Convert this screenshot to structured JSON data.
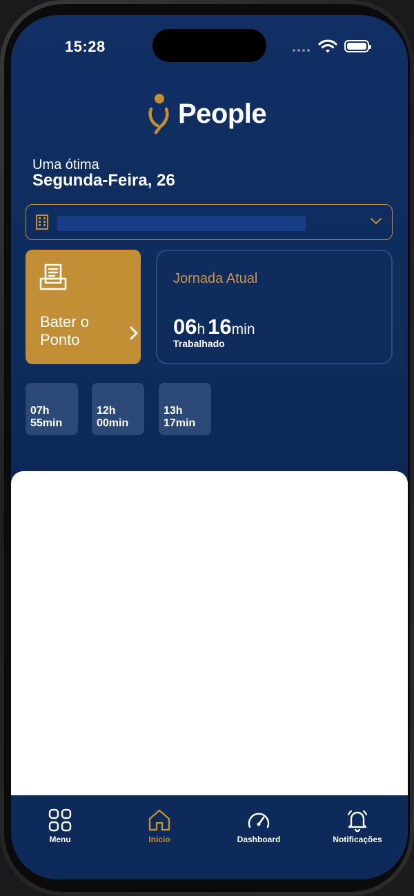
{
  "status_bar": {
    "time": "15:28"
  },
  "brand": {
    "name": "People",
    "accent": "#c28f36",
    "background": "#0e2b5b"
  },
  "header": {
    "greeting": "Uma ótima",
    "date": "Segunda-Feira, 26"
  },
  "company_select": {
    "icon": "building-icon",
    "value": ""
  },
  "punch_card": {
    "label": "Bater o Ponto",
    "icon": "punch-clock-icon"
  },
  "journey": {
    "title": "Jornada Atual",
    "hours": "06",
    "hours_unit": "h",
    "minutes": "16",
    "minutes_unit": "min",
    "caption": "Trabalhado"
  },
  "time_chips": [
    {
      "hours": "07h",
      "minutes": "55min"
    },
    {
      "hours": "12h",
      "minutes": "00min"
    },
    {
      "hours": "13h",
      "minutes": "17min"
    }
  ],
  "tabs": [
    {
      "label": "Menu",
      "icon": "grid-icon",
      "active": false
    },
    {
      "label": "Início",
      "icon": "home-icon",
      "active": true
    },
    {
      "label": "Dashboard",
      "icon": "speedometer-icon",
      "active": false
    },
    {
      "label": "Notificações",
      "icon": "bell-icon",
      "active": false
    }
  ]
}
